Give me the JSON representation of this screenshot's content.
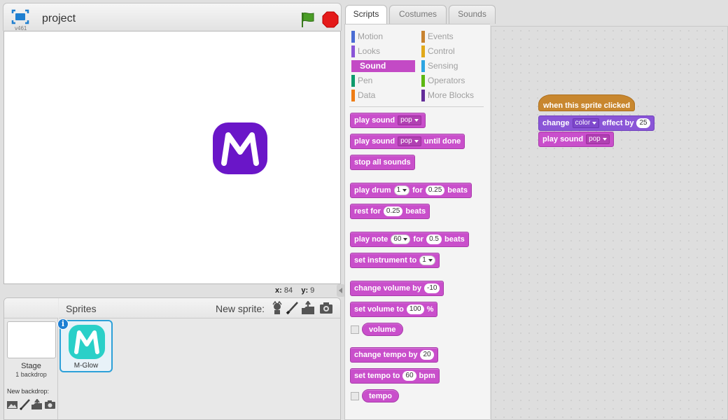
{
  "stage_header": {
    "version": "v461",
    "project_title": "project"
  },
  "coordinates": {
    "x_label": "x:",
    "x_value": "84",
    "y_label": "y:",
    "y_value": "9"
  },
  "sprite_library": {
    "sprites_label": "Sprites",
    "new_sprite_label": "New sprite:",
    "stage_label": "Stage",
    "backdrop_count": "1 backdrop",
    "new_backdrop_label": "New backdrop:",
    "sprites": [
      {
        "name": "M-Glow",
        "selected": true
      }
    ]
  },
  "tabs": [
    "Scripts",
    "Costumes",
    "Sounds"
  ],
  "categories": [
    {
      "label": "Motion",
      "color": "#4a6cd4"
    },
    {
      "label": "Events",
      "color": "#c88330"
    },
    {
      "label": "Looks",
      "color": "#8a55d7"
    },
    {
      "label": "Control",
      "color": "#e1a91a"
    },
    {
      "label": "Sound",
      "color": "#c94fcb",
      "active": true
    },
    {
      "label": "Sensing",
      "color": "#2ca5e2"
    },
    {
      "label": "Pen",
      "color": "#0e9a6c"
    },
    {
      "label": "Operators",
      "color": "#5cb712"
    },
    {
      "label": "Data",
      "color": "#ee7d16"
    },
    {
      "label": "More Blocks",
      "color": "#632d99"
    }
  ],
  "palette_blocks": {
    "play_sound": {
      "text": "play sound",
      "dropdown": "pop"
    },
    "play_sound_until_done": {
      "text": "play sound",
      "dropdown": "pop",
      "suffix": "until done"
    },
    "stop_all_sounds": {
      "text": "stop all sounds"
    },
    "play_drum": {
      "text": "play drum",
      "drum": "1",
      "for": "for",
      "beats_value": "0.25",
      "beats": "beats"
    },
    "rest_for": {
      "text": "rest for",
      "value": "0.25",
      "beats": "beats"
    },
    "play_note": {
      "text": "play note",
      "note": "60",
      "for": "for",
      "beats_value": "0.5",
      "beats": "beats"
    },
    "set_instrument": {
      "text": "set instrument to",
      "value": "1"
    },
    "change_volume": {
      "text": "change volume by",
      "value": "-10"
    },
    "set_volume": {
      "text": "set volume to",
      "value": "100",
      "unit": "%"
    },
    "volume_reporter": {
      "text": "volume"
    },
    "change_tempo": {
      "text": "change tempo by",
      "value": "20"
    },
    "set_tempo": {
      "text": "set tempo to",
      "value": "60",
      "unit": "bpm"
    },
    "tempo_reporter": {
      "text": "tempo"
    }
  },
  "script": {
    "hat": "when this sprite clicked",
    "change_effect": {
      "text": "change",
      "dropdown": "color",
      "middle": "effect by",
      "value": "25"
    },
    "play_sound": {
      "text": "play sound",
      "dropdown": "pop"
    }
  },
  "colors": {
    "sound": "#c94fcb",
    "looks": "#8a55d7",
    "events": "#c8872f",
    "sprite_glyph": "#6a16c8",
    "sprite_thumb_glyph": "#2ad0c8"
  }
}
